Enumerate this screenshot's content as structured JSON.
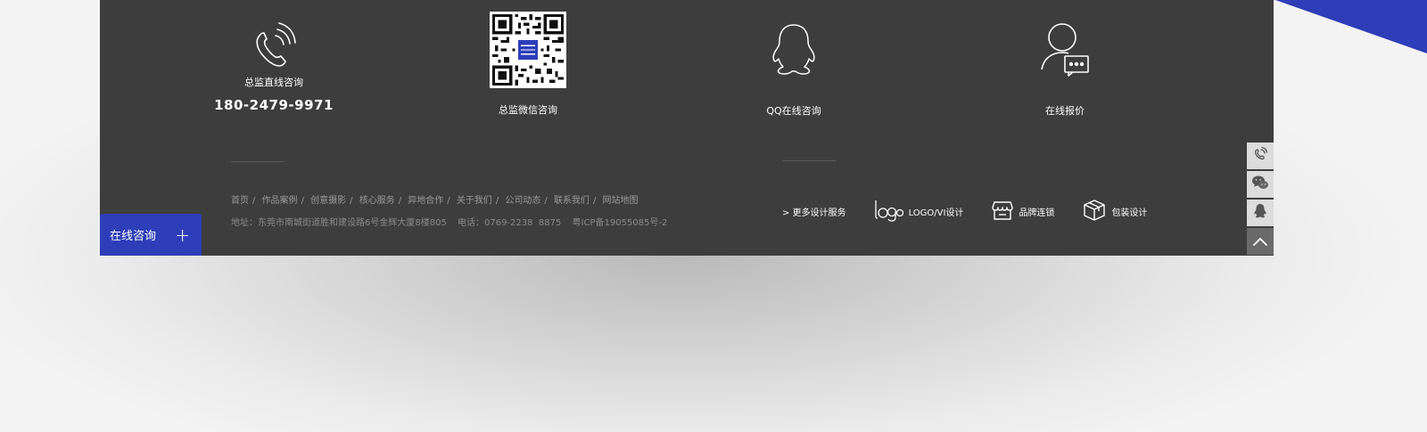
{
  "contacts": {
    "phone": {
      "label": "总监直线咨询",
      "number": "180-2479-9971",
      "icon": "phone-icon"
    },
    "wechat": {
      "label": "总监微信咨询",
      "icon": "qr-code"
    },
    "qq": {
      "label": "QQ在线咨询",
      "icon": "qq-icon"
    },
    "quote": {
      "label": "在线报价",
      "icon": "user-chat-icon"
    }
  },
  "footer_links": [
    "首页",
    "作品案例",
    "创意摄影",
    "核心服务",
    "异地合作",
    "关于我们",
    "公司动态",
    "联系我们",
    "网站地图"
  ],
  "address": {
    "address": "地址：东莞市南城街道胜和建设路6号金辉大厦8楼805",
    "tel": "电话：0769-2238  8875",
    "icp": "粤ICP备19055085号-2"
  },
  "services": {
    "more": "> 更多设计服务",
    "items": [
      {
        "label": "LOGO/VI设计",
        "icon": "logo-icon"
      },
      {
        "label": "品牌连锁",
        "icon": "store-icon"
      },
      {
        "label": "包装设计",
        "icon": "box-icon"
      }
    ]
  },
  "consult": {
    "label": "在线咨询",
    "plus": "+"
  },
  "colors": {
    "accent": "#2d3eb8",
    "footer_bg": "#3d3d3d"
  }
}
